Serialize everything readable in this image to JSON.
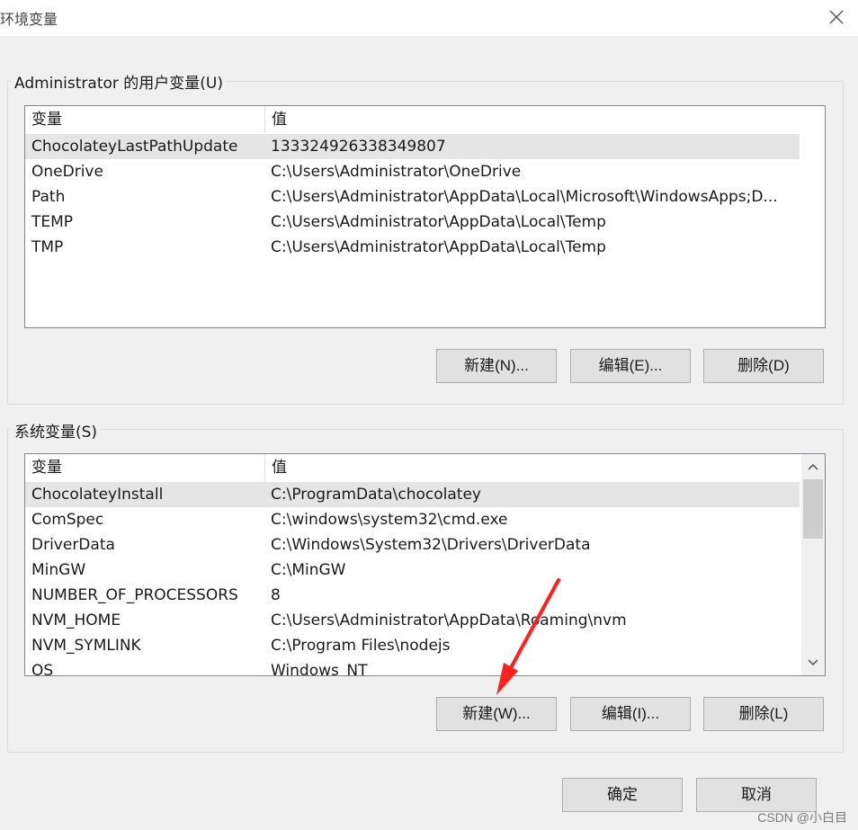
{
  "window": {
    "title": "环境变量",
    "close_icon": "close-icon"
  },
  "user_vars": {
    "group_label": "Administrator 的用户变量(U)",
    "headers": [
      "变量",
      "值"
    ],
    "rows": [
      {
        "name": "ChocolateyLastPathUpdate",
        "value": "133324926338349807",
        "selected": true
      },
      {
        "name": "OneDrive",
        "value": "C:\\Users\\Administrator\\OneDrive"
      },
      {
        "name": "Path",
        "value": "C:\\Users\\Administrator\\AppData\\Local\\Microsoft\\WindowsApps;D..."
      },
      {
        "name": "TEMP",
        "value": "C:\\Users\\Administrator\\AppData\\Local\\Temp"
      },
      {
        "name": "TMP",
        "value": "C:\\Users\\Administrator\\AppData\\Local\\Temp"
      }
    ],
    "buttons": {
      "new": "新建(N)...",
      "edit": "编辑(E)...",
      "delete": "删除(D)"
    }
  },
  "system_vars": {
    "group_label": "系统变量(S)",
    "headers": [
      "变量",
      "值"
    ],
    "rows": [
      {
        "name": "ChocolateyInstall",
        "value": "C:\\ProgramData\\chocolatey",
        "selected": true
      },
      {
        "name": "ComSpec",
        "value": "C:\\windows\\system32\\cmd.exe"
      },
      {
        "name": "DriverData",
        "value": "C:\\Windows\\System32\\Drivers\\DriverData"
      },
      {
        "name": "MinGW",
        "value": "C:\\MinGW"
      },
      {
        "name": "NUMBER_OF_PROCESSORS",
        "value": "8"
      },
      {
        "name": "NVM_HOME",
        "value": "C:\\Users\\Administrator\\AppData\\Roaming\\nvm"
      },
      {
        "name": "NVM_SYMLINK",
        "value": "C:\\Program Files\\nodejs"
      },
      {
        "name": "OS",
        "value": "Windows_NT"
      }
    ],
    "buttons": {
      "new": "新建(W)...",
      "edit": "编辑(I)...",
      "delete": "删除(L)"
    },
    "scrollbar": {
      "up_icon": "chevron-up-icon",
      "down_icon": "chevron-down-icon"
    }
  },
  "footer": {
    "ok": "确定",
    "cancel": "取消"
  },
  "watermark": "CSDN @小白目",
  "colors": {
    "annotation_arrow": "#ff2020",
    "selected_row": "#e5e5e5",
    "button_bg": "#e1e1e1"
  }
}
